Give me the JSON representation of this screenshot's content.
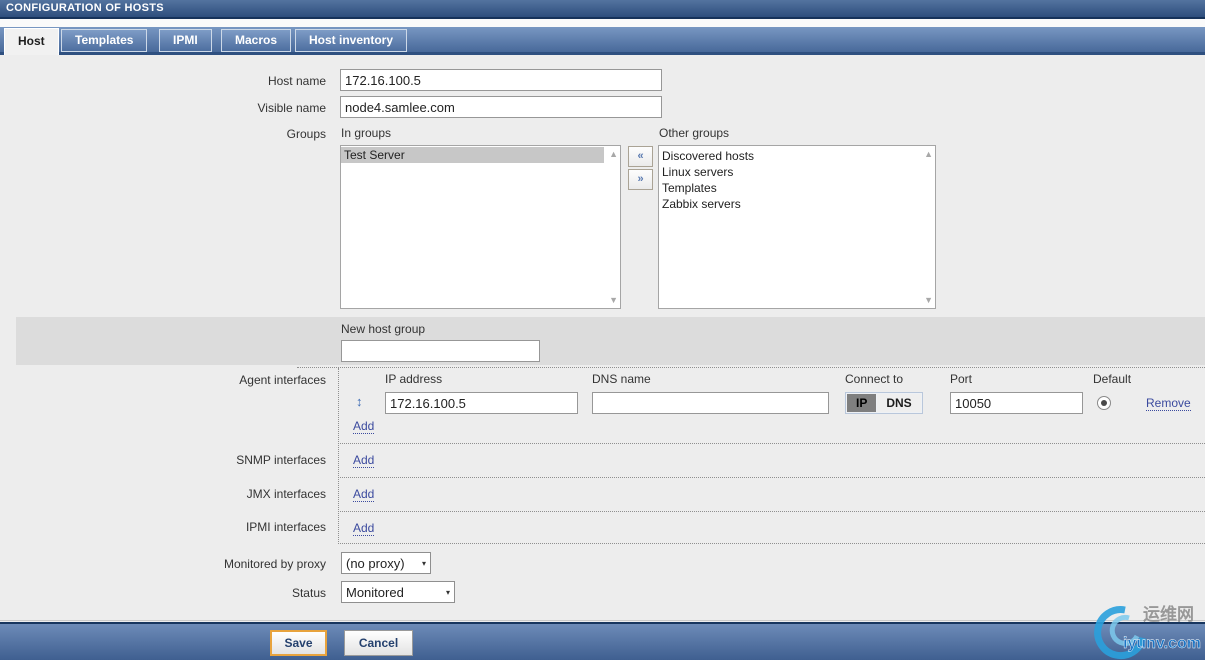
{
  "header": {
    "title": "CONFIGURATION OF HOSTS"
  },
  "tabs": [
    {
      "label": "Host",
      "active": true
    },
    {
      "label": "Templates",
      "active": false
    },
    {
      "label": "IPMI",
      "active": false
    },
    {
      "label": "Macros",
      "active": false
    },
    {
      "label": "Host inventory",
      "active": false
    }
  ],
  "form": {
    "host_name": {
      "label": "Host name",
      "value": "172.16.100.5"
    },
    "visible_name": {
      "label": "Visible name",
      "value": "node4.samlee.com"
    },
    "groups": {
      "label": "Groups",
      "in_groups": {
        "label": "In groups",
        "items": [
          "Test Server"
        ],
        "selected": "Test Server"
      },
      "other_groups": {
        "label": "Other groups",
        "items": [
          "Discovered hosts",
          "Linux servers",
          "Templates",
          "Zabbix servers"
        ]
      },
      "move_left_glyph": "«",
      "move_right_glyph": "»",
      "scroll_up_glyph": "▲",
      "scroll_down_glyph": "▼"
    },
    "new_host_group": {
      "label": "New host group",
      "value": ""
    },
    "agent_interfaces": {
      "label": "Agent interfaces",
      "columns": {
        "ip": "IP address",
        "dns": "DNS name",
        "connect": "Connect to",
        "port": "Port",
        "default": "Default"
      },
      "row": {
        "drag_glyph": "↕",
        "ip_value": "172.16.100.5",
        "dns_value": "",
        "connect_ip": "IP",
        "connect_dns": "DNS",
        "connect_selected": "IP",
        "port_value": "10050",
        "default_checked": true,
        "remove_label": "Remove"
      },
      "add_label": "Add"
    },
    "snmp_interfaces": {
      "label": "SNMP interfaces",
      "add_label": "Add"
    },
    "jmx_interfaces": {
      "label": "JMX interfaces",
      "add_label": "Add"
    },
    "ipmi_interfaces": {
      "label": "IPMI interfaces",
      "add_label": "Add"
    },
    "monitored_by_proxy": {
      "label": "Monitored by proxy",
      "value": "(no proxy)",
      "arrow": "▾"
    },
    "status": {
      "label": "Status",
      "value": "Monitored",
      "arrow": "▾"
    }
  },
  "footer": {
    "save_label": "Save",
    "cancel_label": "Cancel"
  },
  "watermark": {
    "line1": "运维网",
    "line2": "iyunv.com"
  },
  "colors": {
    "header_blue": "#2e4e7d",
    "tabbar_blue": "#48699a",
    "active_tab_bg": "#f1f1f1",
    "content_bg": "#ededed",
    "band_gray": "#dcdcdc",
    "link_blue": "#3b4a9e",
    "selected_item_gray": "#c7c7c7",
    "save_border_orange": "#e8a33d",
    "segment_active_gray": "#7f7f7f"
  }
}
